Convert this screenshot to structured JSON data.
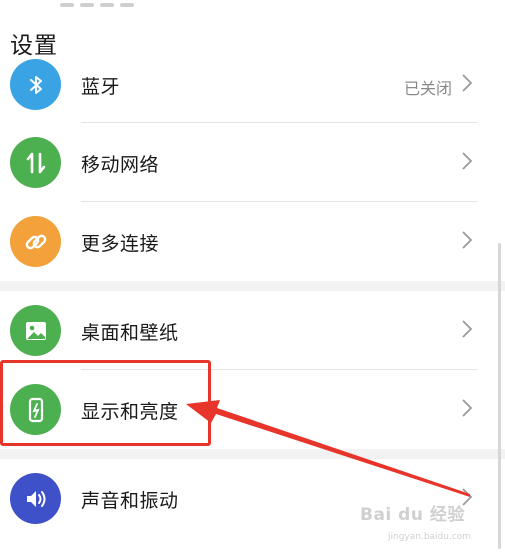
{
  "page_title": "设置",
  "items": [
    {
      "id": "bluetooth",
      "label": "蓝牙",
      "status": "已关闭",
      "icon": "bluetooth-icon",
      "color": "#3aa3e3"
    },
    {
      "id": "mobile-network",
      "label": "移动网络",
      "status": "",
      "icon": "mobile-data-icon",
      "color": "#4cb050"
    },
    {
      "id": "more-connections",
      "label": "更多连接",
      "status": "",
      "icon": "link-icon",
      "color": "#f2a13b"
    },
    {
      "id": "wallpaper",
      "label": "桌面和壁纸",
      "status": "",
      "icon": "image-icon",
      "color": "#4cb050"
    },
    {
      "id": "display",
      "label": "显示和亮度",
      "status": "",
      "icon": "phone-brightness-icon",
      "color": "#4cb050"
    },
    {
      "id": "sound",
      "label": "声音和振动",
      "status": "",
      "icon": "speaker-icon",
      "color": "#3f51c8"
    }
  ],
  "annotation": {
    "highlight_color": "#e8352b",
    "target": "display"
  },
  "watermark": {
    "text": "Bai du 经验",
    "sub": "jingyan.baidu.com"
  }
}
